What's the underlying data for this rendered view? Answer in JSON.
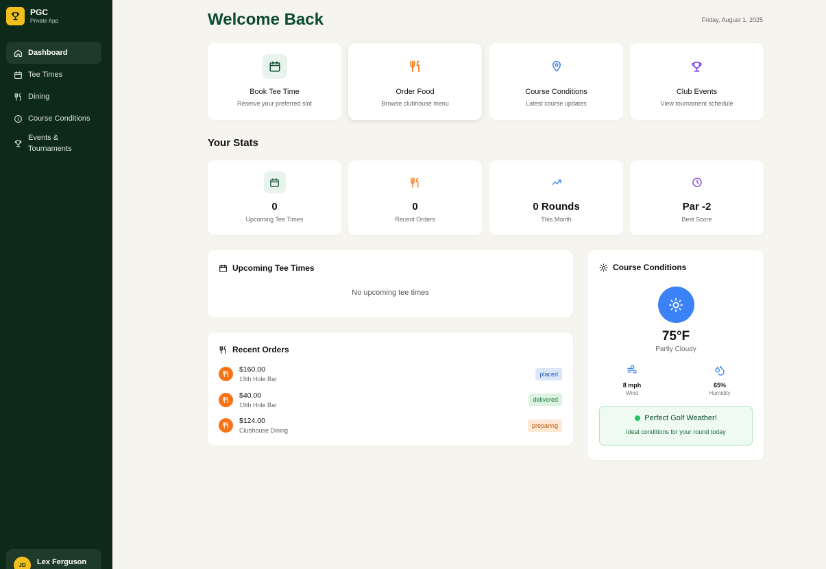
{
  "app": {
    "name": "PGC",
    "subtitle": "Private App"
  },
  "sidebar": {
    "items": [
      {
        "label": "Dashboard",
        "icon": "home-icon",
        "active": true
      },
      {
        "label": "Tee Times",
        "icon": "calendar-icon"
      },
      {
        "label": "Dining",
        "icon": "utensils-icon"
      },
      {
        "label": "Course Conditions",
        "icon": "info-icon"
      },
      {
        "label": "Events & Tournaments",
        "icon": "trophy-icon"
      }
    ],
    "user": {
      "initials": "JD",
      "name": "Lex Ferguson"
    }
  },
  "header": {
    "title": "Welcome Back",
    "date": "Friday, August 1, 2025"
  },
  "quick_actions": [
    {
      "title": "Book Tee Time",
      "subtitle": "Reserve your preferred slot",
      "icon": "calendar-icon",
      "color": "#0d4a2e"
    },
    {
      "title": "Order Food",
      "subtitle": "Browse clubhouse menu",
      "icon": "utensils-icon",
      "color": "#f97316"
    },
    {
      "title": "Course Conditions",
      "subtitle": "Latest course updates",
      "icon": "map-pin-icon",
      "color": "#3b82f6"
    },
    {
      "title": "Club Events",
      "subtitle": "View tournament schedule",
      "icon": "trophy-icon",
      "color": "#7c3aed"
    }
  ],
  "stats": {
    "title": "Your Stats",
    "items": [
      {
        "value": "0",
        "label": "Upcoming Tee Times",
        "icon": "calendar-icon",
        "color": "#0d4a2e"
      },
      {
        "value": "0",
        "label": "Recent Orders",
        "icon": "utensils-icon",
        "color": "#f97316"
      },
      {
        "value": "0 Rounds",
        "label": "This Month",
        "icon": "trending-up-icon",
        "color": "#3b82f6"
      },
      {
        "value": "Par -2",
        "label": "Best Score",
        "icon": "clock-icon",
        "color": "#7c3aed"
      }
    ]
  },
  "tee_times": {
    "title": "Upcoming Tee Times",
    "empty": "No upcoming tee times"
  },
  "orders": {
    "title": "Recent Orders",
    "items": [
      {
        "amount": "$160.00",
        "place": "19th Hole Bar",
        "status": "placed"
      },
      {
        "amount": "$40.00",
        "place": "19th Hole Bar",
        "status": "delivered"
      },
      {
        "amount": "$124.00",
        "place": "Clubhouse Dining",
        "status": "preparing"
      }
    ]
  },
  "conditions": {
    "title": "Course Conditions",
    "temperature": "75°F",
    "summary": "Partly Cloudy",
    "wind": {
      "value": "8 mph",
      "label": "Wind"
    },
    "humidity": {
      "value": "65%",
      "label": "Humidity"
    },
    "banner": {
      "title": "Perfect Golf Weather!",
      "subtitle": "Ideal conditions for your round today"
    }
  }
}
